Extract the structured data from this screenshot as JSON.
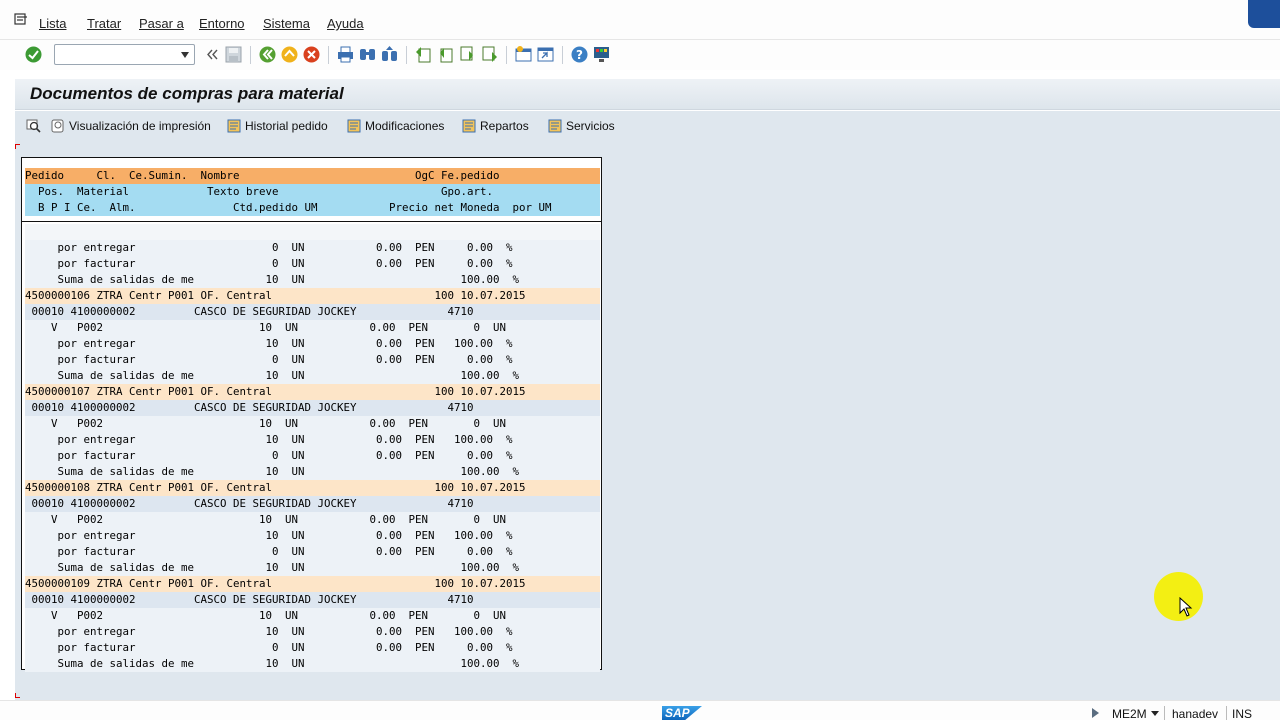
{
  "menu": {
    "items": [
      {
        "label": "Lista"
      },
      {
        "label": "Tratar"
      },
      {
        "label": "Pasar a"
      },
      {
        "label": "Entorno"
      },
      {
        "label": "Sistema"
      },
      {
        "label": "Ayuda"
      }
    ]
  },
  "toolbar": {
    "command_value": "",
    "icons": [
      "check-icon",
      "back-double-icon",
      "save-icon",
      "back-icon",
      "exit-icon",
      "cancel-icon",
      "print-icon",
      "find-icon",
      "find-next-icon",
      "first-page-icon",
      "prev-page-icon",
      "next-page-icon",
      "last-page-icon",
      "create-session-icon",
      "shortcut-icon",
      "help-icon",
      "customize-icon"
    ]
  },
  "title": "Documentos de compras para material",
  "app_toolbar": {
    "buttons": [
      {
        "label": ""
      },
      {
        "label": "Visualización de impresión"
      },
      {
        "label": "Historial pedido"
      },
      {
        "label": "Modificaciones"
      },
      {
        "label": "Repartos"
      },
      {
        "label": "Servicios"
      }
    ]
  },
  "list": {
    "header": [
      "Pedido     Cl.  Ce.Sumin.  Nombre                           OgC Fe.pedido",
      "  Pos.  Material            Texto breve                         Gpo.art.",
      "  B P I Ce.  Alm.               Ctd.pedido UM           Precio net Moneda  por UM"
    ],
    "rows": [
      {
        "type": "blank",
        "text": ""
      },
      {
        "type": "line",
        "text": "     por entregar                     0  UN           0.00  PEN     0.00  %"
      },
      {
        "type": "line",
        "text": "     por facturar                     0  UN           0.00  PEN     0.00  %"
      },
      {
        "type": "line",
        "text": "     Suma de salidas de me           10  UN                        100.00  %"
      },
      {
        "type": "doc",
        "text": "4500000106 ZTRA Centr P001 OF. Central                         100 10.07.2015"
      },
      {
        "type": "item",
        "text": " 00010 4100000002         CASCO DE SEGURIDAD JOCKEY              4710"
      },
      {
        "type": "line",
        "text": "    V   P002                        10  UN           0.00  PEN       0  UN"
      },
      {
        "type": "line",
        "text": "     por entregar                    10  UN           0.00  PEN   100.00  %"
      },
      {
        "type": "line",
        "text": "     por facturar                     0  UN           0.00  PEN     0.00  %"
      },
      {
        "type": "line",
        "text": "     Suma de salidas de me           10  UN                        100.00  %"
      },
      {
        "type": "doc",
        "text": "4500000107 ZTRA Centr P001 OF. Central                         100 10.07.2015"
      },
      {
        "type": "item",
        "text": " 00010 4100000002         CASCO DE SEGURIDAD JOCKEY              4710"
      },
      {
        "type": "line",
        "text": "    V   P002                        10  UN           0.00  PEN       0  UN"
      },
      {
        "type": "line",
        "text": "     por entregar                    10  UN           0.00  PEN   100.00  %"
      },
      {
        "type": "line",
        "text": "     por facturar                     0  UN           0.00  PEN     0.00  %"
      },
      {
        "type": "line",
        "text": "     Suma de salidas de me           10  UN                        100.00  %"
      },
      {
        "type": "doc",
        "text": "4500000108 ZTRA Centr P001 OF. Central                         100 10.07.2015"
      },
      {
        "type": "item",
        "text": " 00010 4100000002         CASCO DE SEGURIDAD JOCKEY              4710"
      },
      {
        "type": "line",
        "text": "    V   P002                        10  UN           0.00  PEN       0  UN"
      },
      {
        "type": "line",
        "text": "     por entregar                    10  UN           0.00  PEN   100.00  %"
      },
      {
        "type": "line",
        "text": "     por facturar                     0  UN           0.00  PEN     0.00  %"
      },
      {
        "type": "line",
        "text": "     Suma de salidas de me           10  UN                        100.00  %"
      },
      {
        "type": "doc",
        "text": "4500000109 ZTRA Centr P001 OF. Central                         100 10.07.2015"
      },
      {
        "type": "item",
        "text": " 00010 4100000002         CASCO DE SEGURIDAD JOCKEY              4710"
      },
      {
        "type": "line",
        "text": "    V   P002                        10  UN           0.00  PEN       0  UN"
      },
      {
        "type": "line",
        "text": "     por entregar                    10  UN           0.00  PEN   100.00  %"
      },
      {
        "type": "line",
        "text": "     por facturar                     0  UN           0.00  PEN     0.00  %"
      },
      {
        "type": "line",
        "text": "     Suma de salidas de me           10  UN                        100.00  %"
      }
    ]
  },
  "status": {
    "logo": "SAP",
    "transaction": "ME2M",
    "system": "hanadev",
    "mode": "INS"
  },
  "colors": {
    "header_row": "#f7ae67",
    "subheader_row": "#a4dcf2",
    "document_row": "#fde5c8",
    "work_area": "#dfe7ee"
  }
}
